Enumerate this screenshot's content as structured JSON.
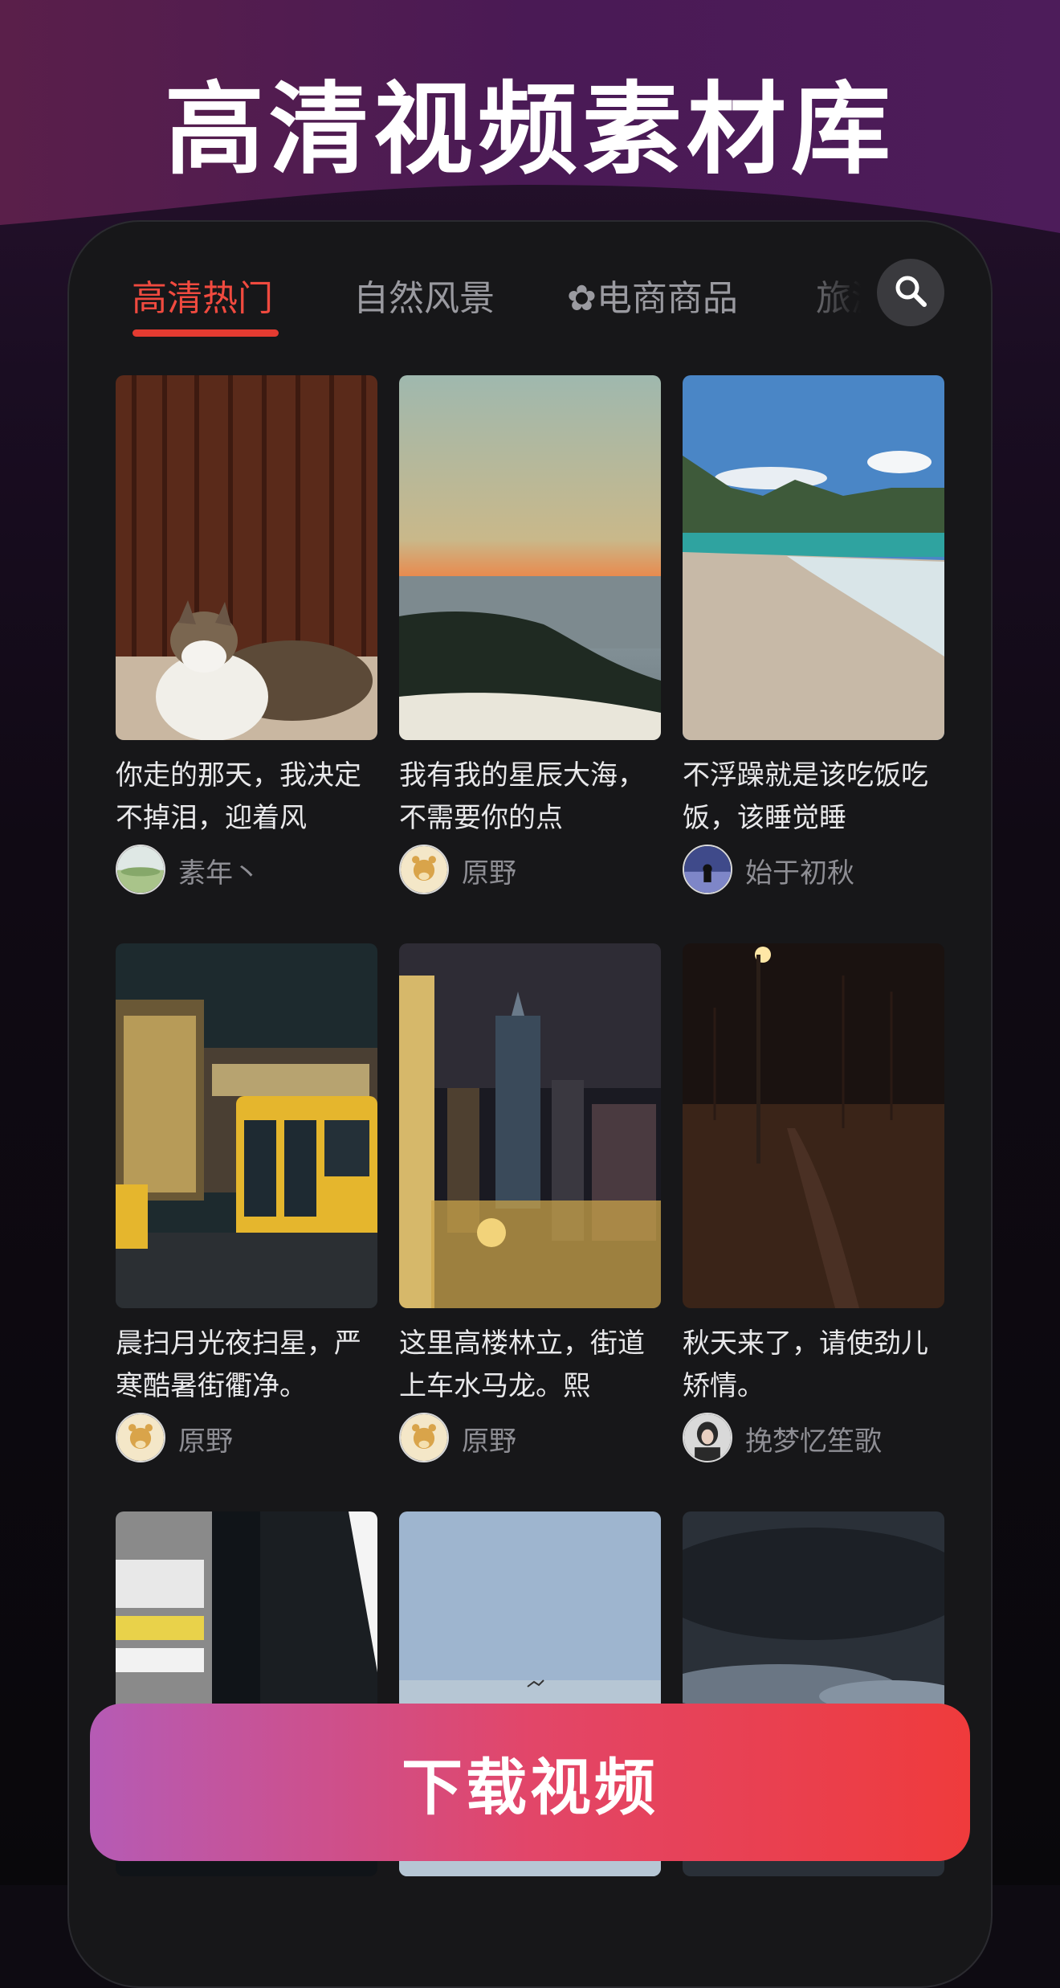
{
  "promo": {
    "headline": "高清视频素材库"
  },
  "tabs": [
    {
      "label": "高清热门",
      "active": true
    },
    {
      "label": "自然风景",
      "active": false
    },
    {
      "label": "✿电商商品",
      "active": false
    },
    {
      "label": "旅游",
      "active": false
    }
  ],
  "search": {
    "icon": "search-icon"
  },
  "videos": [
    {
      "caption": "你走的那天，我决定不掉泪，迎着风",
      "author": "素年丶",
      "thumb": "cat-on-floor"
    },
    {
      "caption": "我有我的星辰大海，不需要你的点",
      "author": "原野",
      "thumb": "sunset-over-sea"
    },
    {
      "caption": "不浮躁就是该吃饭吃饭，该睡觉睡",
      "author": "始于初秋",
      "thumb": "beach-with-mountains"
    },
    {
      "caption": "晨扫月光夜扫星，严寒酷暑街衢净。",
      "author": "原野",
      "thumb": "night-street-bus"
    },
    {
      "caption": "这里高楼林立，街道上车水马龙。熙",
      "author": "原野",
      "thumb": "city-skyline-night"
    },
    {
      "caption": "秋天来了，请使劲儿矫情。",
      "author": "挽梦忆笙歌",
      "thumb": "autumn-park-night"
    },
    {
      "caption": "",
      "author": "",
      "thumb": "street-poster-night"
    },
    {
      "caption": "",
      "author": "",
      "thumb": "sea-with-birds"
    },
    {
      "caption": "",
      "author": "",
      "thumb": "dark-clouds"
    }
  ],
  "download_button": {
    "label": "下载视频"
  },
  "colors": {
    "accent": "#e43b31",
    "card_bg": "#171719",
    "button_start": "#b55bb5",
    "button_end": "#ef3b3c"
  }
}
